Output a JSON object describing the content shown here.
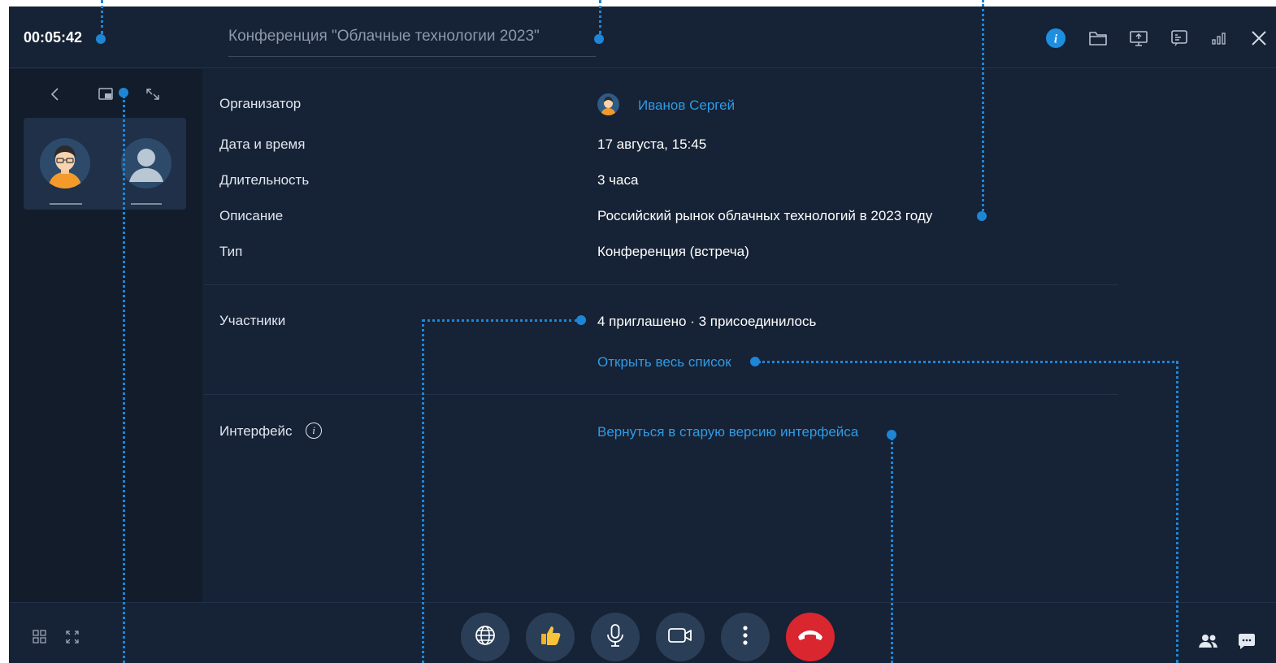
{
  "header": {
    "timer": "00:05:42",
    "title": "Конференция \"Облачные технологии 2023\""
  },
  "details": {
    "organizer_label": "Организатор",
    "organizer_name": "Иванов Сергей",
    "datetime_label": "Дата и время",
    "datetime_value": "17 августа, 15:45",
    "duration_label": "Длительность",
    "duration_value": "3 часа",
    "description_label": "Описание",
    "description_value": "Российский рынок облачных технологий в 2023 году",
    "type_label": "Тип",
    "type_value": "Конференция (встреча)"
  },
  "participants": {
    "label": "Участники",
    "summary": "4 приглашено · 3 присоединилось",
    "open_list": "Открыть весь список"
  },
  "interface": {
    "label": "Интерфейс",
    "info_glyph": "i",
    "revert_link": "Вернуться в старую версию интерфейса"
  },
  "colors": {
    "background": "#162235",
    "panel": "#121c2b",
    "accent": "#1d86d6",
    "link": "#2f9be6",
    "end_call": "#d9262f"
  },
  "icons": {
    "header": [
      "info-icon",
      "folder-icon",
      "screen-share-icon",
      "whiteboard-icon",
      "signal-icon",
      "close-icon"
    ],
    "controls": [
      "globe-icon",
      "thumbs-up-icon",
      "microphone-icon",
      "camera-icon",
      "more-icon",
      "end-call-icon"
    ]
  }
}
